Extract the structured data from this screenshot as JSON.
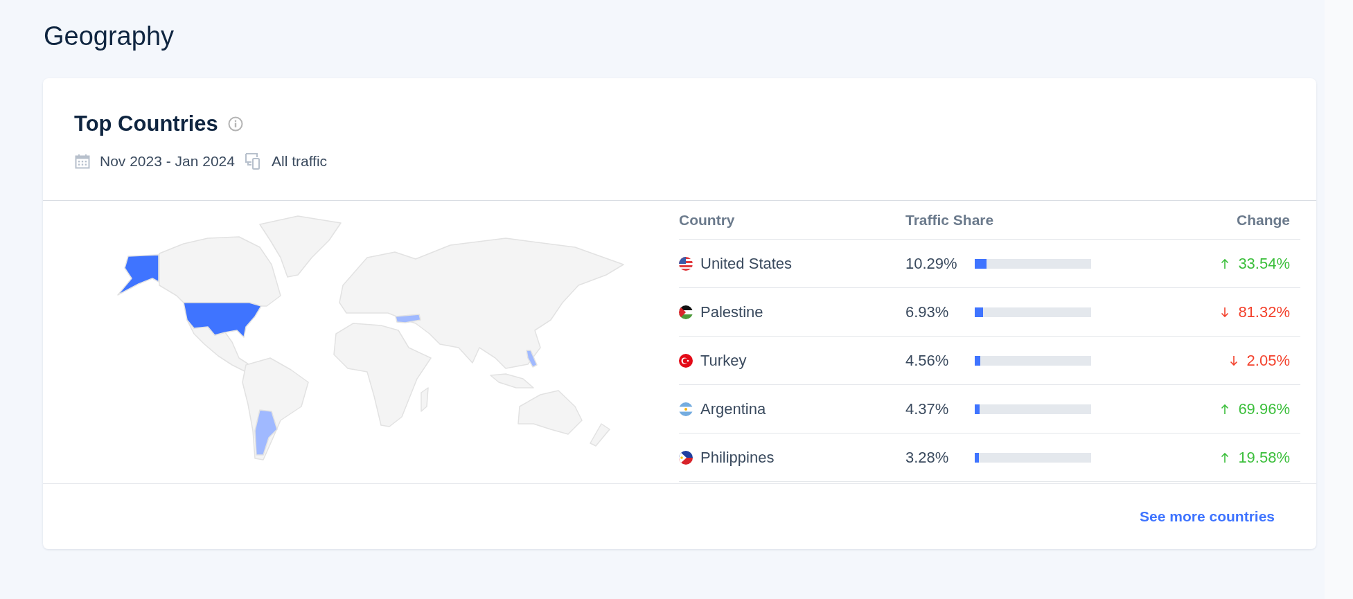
{
  "page_title": "Geography",
  "card": {
    "title": "Top Countries",
    "date_range": "Nov 2023 - Jan 2024",
    "traffic": "All traffic"
  },
  "table": {
    "columns": [
      "Country",
      "Traffic Share",
      "Change"
    ],
    "rows": [
      {
        "country": "United States",
        "share": "10.29%",
        "level": 0.1029,
        "change": "33.54%",
        "rising": true
      },
      {
        "country": "Palestine",
        "share": "6.93%",
        "level": 0.0693,
        "change": "81.32%",
        "rising": false
      },
      {
        "country": "Turkey",
        "share": "4.56%",
        "level": 0.0456,
        "change": "2.05%",
        "rising": false
      },
      {
        "country": "Argentina",
        "share": "4.37%",
        "level": 0.0437,
        "change": "69.96%",
        "rising": true
      },
      {
        "country": "Philippines",
        "share": "3.28%",
        "level": 0.0328,
        "change": "19.58%",
        "rising": true
      }
    ]
  },
  "link": "See more countries"
}
